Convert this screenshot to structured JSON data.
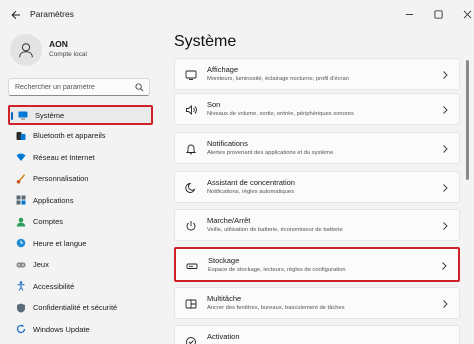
{
  "window": {
    "title": "Paramètres"
  },
  "user": {
    "name": "AON",
    "account_type": "Compte local"
  },
  "search": {
    "placeholder": "Rechercher un paramètre"
  },
  "sidebar": {
    "items": [
      {
        "label": "Système",
        "icon": "monitor-icon",
        "selected": true
      },
      {
        "label": "Bluetooth et appareils",
        "icon": "bluetooth-icon"
      },
      {
        "label": "Réseau et Internet",
        "icon": "wifi-icon"
      },
      {
        "label": "Personnalisation",
        "icon": "brush-icon"
      },
      {
        "label": "Applications",
        "icon": "apps-icon"
      },
      {
        "label": "Comptes",
        "icon": "person-icon"
      },
      {
        "label": "Heure et langue",
        "icon": "globe-clock-icon"
      },
      {
        "label": "Jeux",
        "icon": "gamepad-icon"
      },
      {
        "label": "Accessibilité",
        "icon": "accessibility-icon"
      },
      {
        "label": "Confidentialité et sécurité",
        "icon": "shield-icon"
      },
      {
        "label": "Windows Update",
        "icon": "update-icon"
      }
    ]
  },
  "main": {
    "title": "Système",
    "cards": [
      {
        "title": "Affichage",
        "desc": "Moniteurs, luminosité, éclairage nocturne, profil d'écran",
        "icon": "display-icon"
      },
      {
        "title": "Son",
        "desc": "Niveaux de volume, sortie, entrée, périphériques sonores",
        "icon": "speaker-icon"
      },
      {
        "title": "Notifications",
        "desc": "Alertes provenant des applications et du système",
        "icon": "bell-icon"
      },
      {
        "title": "Assistant de concentration",
        "desc": "Notifications, règles automatiques",
        "icon": "moon-icon"
      },
      {
        "title": "Marche/Arrêt",
        "desc": "Veille, utilisation de batterie, économiseur de batterie",
        "icon": "power-icon"
      },
      {
        "title": "Stockage",
        "desc": "Espace de stockage, lecteurs, règles de configuration",
        "icon": "storage-icon",
        "highlighted": true
      },
      {
        "title": "Multitâche",
        "desc": "Ancrer des fenêtres, bureaux, basculement de tâches",
        "icon": "multitask-icon"
      },
      {
        "title": "Activation",
        "desc": "",
        "icon": "activation-icon"
      }
    ]
  },
  "colors": {
    "accent": "#0067c0",
    "highlight_border": "#d0202a",
    "background": "#f3f3f3",
    "card": "#fbfbfb"
  }
}
